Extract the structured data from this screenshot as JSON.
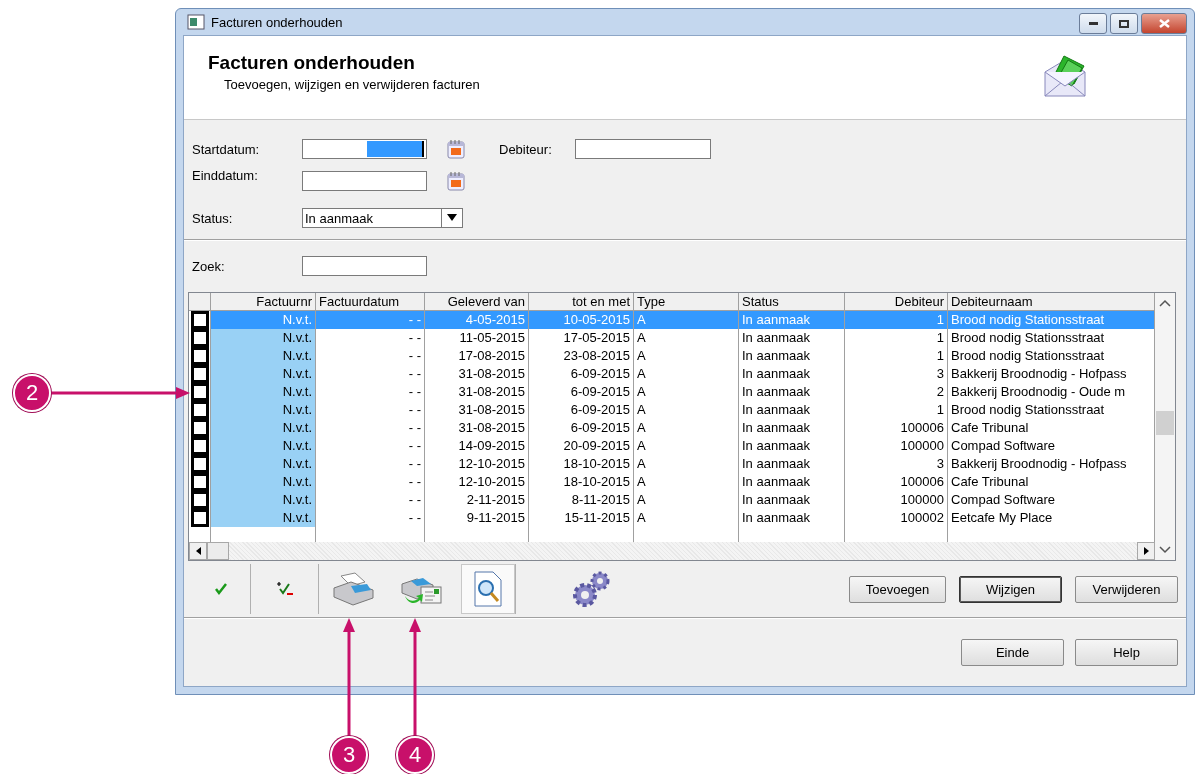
{
  "window": {
    "title": "Facturen onderhouden"
  },
  "header": {
    "title": "Facturen onderhouden",
    "subtitle": "Toevoegen, wijzigen en verwijderen facturen"
  },
  "filters": {
    "start_date": {
      "label": "Startdatum:"
    },
    "end_date": {
      "label": "Einddatum:"
    },
    "debtor": {
      "label": "Debiteur:"
    },
    "status": {
      "label": "Status:",
      "value": "In aanmaak"
    },
    "search": {
      "label": "Zoek:"
    }
  },
  "table": {
    "columns": [
      "Factuurnr",
      "Factuurdatum",
      "Geleverd van",
      "tot en met",
      "Type",
      "Status",
      "Debiteur",
      "Debiteurnaam"
    ],
    "rows": [
      {
        "checked": false,
        "selected": true,
        "cells": [
          "N.v.t.",
          "- -",
          "4-05-2015",
          "10-05-2015",
          "A",
          "In aanmaak",
          "1",
          "Brood nodig Stationsstraat"
        ]
      },
      {
        "checked": false,
        "selected": false,
        "cells": [
          "N.v.t.",
          "- -",
          "11-05-2015",
          "17-05-2015",
          "A",
          "In aanmaak",
          "1",
          "Brood nodig Stationsstraat"
        ]
      },
      {
        "checked": false,
        "selected": false,
        "cells": [
          "N.v.t.",
          "- -",
          "17-08-2015",
          "23-08-2015",
          "A",
          "In aanmaak",
          "1",
          "Brood nodig Stationsstraat"
        ]
      },
      {
        "checked": false,
        "selected": false,
        "cells": [
          "N.v.t.",
          "- -",
          "31-08-2015",
          "6-09-2015",
          "A",
          "In aanmaak",
          "3",
          "Bakkerij Broodnodig - Hofpass"
        ]
      },
      {
        "checked": false,
        "selected": false,
        "cells": [
          "N.v.t.",
          "- -",
          "31-08-2015",
          "6-09-2015",
          "A",
          "In aanmaak",
          "2",
          "Bakkerij Broodnodig - Oude m"
        ]
      },
      {
        "checked": false,
        "selected": false,
        "cells": [
          "N.v.t.",
          "- -",
          "31-08-2015",
          "6-09-2015",
          "A",
          "In aanmaak",
          "1",
          "Brood nodig Stationsstraat"
        ]
      },
      {
        "checked": false,
        "selected": false,
        "cells": [
          "N.v.t.",
          "- -",
          "31-08-2015",
          "6-09-2015",
          "A",
          "In aanmaak",
          "100006",
          "Cafe Tribunal"
        ]
      },
      {
        "checked": false,
        "selected": false,
        "cells": [
          "N.v.t.",
          "- -",
          "14-09-2015",
          "20-09-2015",
          "A",
          "In aanmaak",
          "100000",
          "Compad Software"
        ]
      },
      {
        "checked": false,
        "selected": false,
        "cells": [
          "N.v.t.",
          "- -",
          "12-10-2015",
          "18-10-2015",
          "A",
          "In aanmaak",
          "3",
          "Bakkerij Broodnodig - Hofpass"
        ]
      },
      {
        "checked": false,
        "selected": false,
        "cells": [
          "N.v.t.",
          "- -",
          "12-10-2015",
          "18-10-2015",
          "A",
          "In aanmaak",
          "100006",
          "Cafe Tribunal"
        ]
      },
      {
        "checked": false,
        "selected": false,
        "cells": [
          "N.v.t.",
          "- -",
          "2-11-2015",
          "8-11-2015",
          "A",
          "In aanmaak",
          "100000",
          "Compad Software"
        ]
      },
      {
        "checked": false,
        "selected": false,
        "cells": [
          "N.v.t.",
          "- -",
          "9-11-2015",
          "15-11-2015",
          "A",
          "In aanmaak",
          "100002",
          "Eetcafe My Place"
        ]
      }
    ]
  },
  "actions": [
    {
      "label": "Toevoegen",
      "default": false
    },
    {
      "label": "Wijzigen",
      "default": true
    },
    {
      "label": "Verwijderen",
      "default": false
    }
  ],
  "footer_buttons": [
    "Einde",
    "Help"
  ],
  "callouts": [
    "2",
    "3",
    "4"
  ]
}
